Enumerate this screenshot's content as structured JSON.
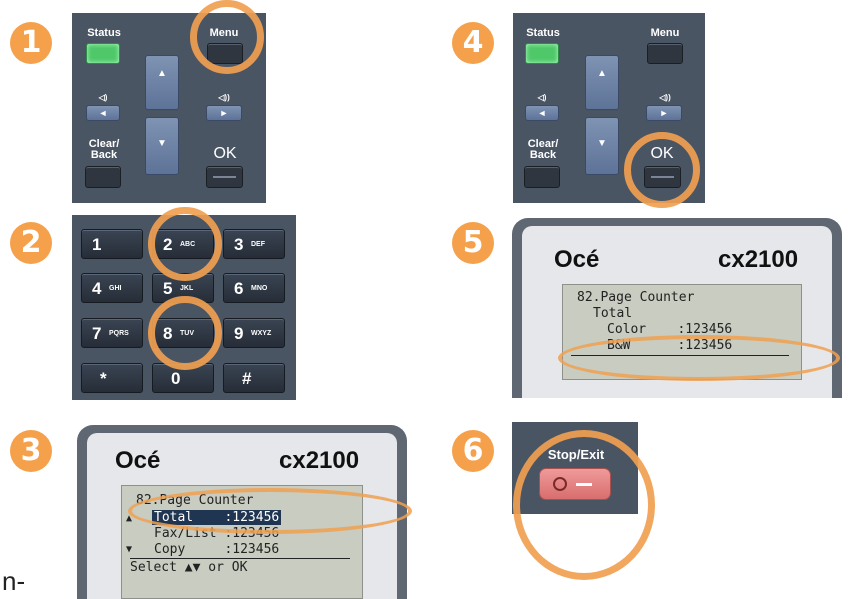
{
  "steps": [
    "1",
    "2",
    "3",
    "4",
    "5",
    "6"
  ],
  "control_panel": {
    "status_label": "Status",
    "menu_label": "Menu",
    "clear_back_line1": "Clear/",
    "clear_back_line2": "Back",
    "ok_label": "OK",
    "vol_down_glyph": "◁)",
    "vol_up_glyph": "◁))",
    "left_glyph": "◄",
    "right_glyph": "►",
    "up_glyph": "▲",
    "down_glyph": "▼"
  },
  "keypad": {
    "keys": [
      {
        "num": "1",
        "sub": ""
      },
      {
        "num": "2",
        "sub": "ABC"
      },
      {
        "num": "3",
        "sub": "DEF"
      },
      {
        "num": "4",
        "sub": "GHI"
      },
      {
        "num": "5",
        "sub": "JKL"
      },
      {
        "num": "6",
        "sub": "MNO"
      },
      {
        "num": "7",
        "sub": "PQRS"
      },
      {
        "num": "8",
        "sub": "TUV"
      },
      {
        "num": "9",
        "sub": "WXYZ"
      },
      {
        "num": "*",
        "sub": ""
      },
      {
        "num": "0",
        "sub": ""
      },
      {
        "num": "#",
        "sub": ""
      }
    ]
  },
  "lcd_step3": {
    "brand": "Océ",
    "model": "cx2100",
    "lines": [
      "82.Page Counter",
      "Total    :123456",
      "Fax/List :123456",
      "Copy     :123456",
      "Select ▲▼ or OK"
    ],
    "up_indicator": "▲",
    "down_indicator": "▼"
  },
  "lcd_step5": {
    "brand": "Océ",
    "model": "cx2100",
    "lines": [
      "82.Page Counter",
      "Total",
      "Color    :123456",
      "B&W      :123456"
    ]
  },
  "stop_exit": {
    "label": "Stop/Exit"
  },
  "side_text": "n-",
  "colors": {
    "accent": "#f0a050",
    "panel": "#4a5564",
    "status_led": "#4fc86a",
    "stop_button": "#e07b7b"
  }
}
